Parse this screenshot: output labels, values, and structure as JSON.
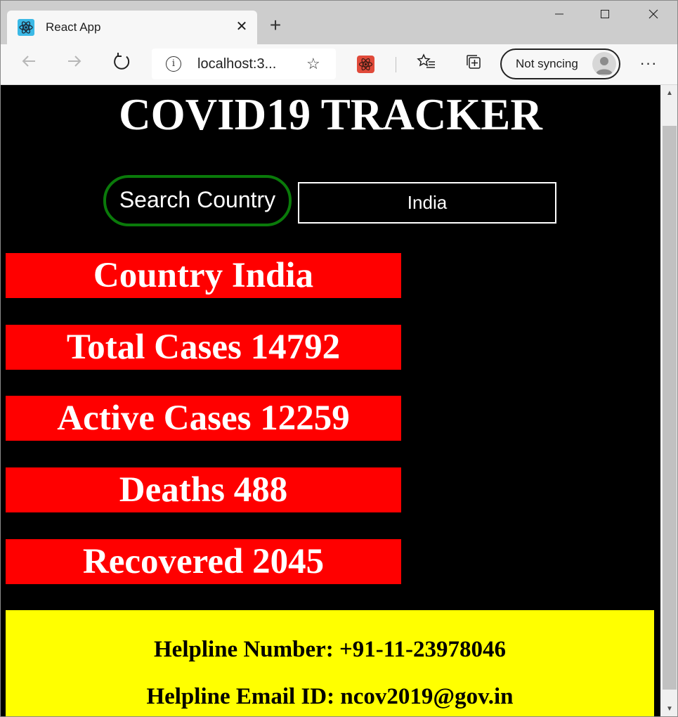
{
  "browser": {
    "tab_title": "React App",
    "address": "localhost:3...",
    "sync_label": "Not syncing"
  },
  "icons": {
    "favicon": "react-icon",
    "close_tab": "close-icon",
    "new_tab": "plus-icon",
    "back": "arrow-left-icon",
    "forward": "arrow-right-icon",
    "refresh": "refresh-icon",
    "info": "info-icon",
    "favorite": "star-add-icon",
    "extension": "react-devtools-icon",
    "favorites_list": "favorites-icon",
    "collections": "collections-icon",
    "profile": "avatar-icon",
    "more": "more-icon"
  },
  "page": {
    "title": "COVID19 TRACKER",
    "search_label": "Search Country",
    "search_value": "India",
    "stats": {
      "country": "Country India",
      "total_cases": "Total Cases 14792",
      "active_cases": "Active Cases 12259",
      "deaths": "Deaths 488",
      "recovered": "Recovered 2045"
    },
    "helpline_number": "Helpline Number: +91-11-23978046",
    "helpline_email": "Helpline Email ID: ncov2019@gov.in"
  },
  "colors": {
    "page_background": "#000000",
    "stat_background": "#ff0000",
    "helpline_background": "#ffff00",
    "search_border": "#0a7a0a"
  }
}
